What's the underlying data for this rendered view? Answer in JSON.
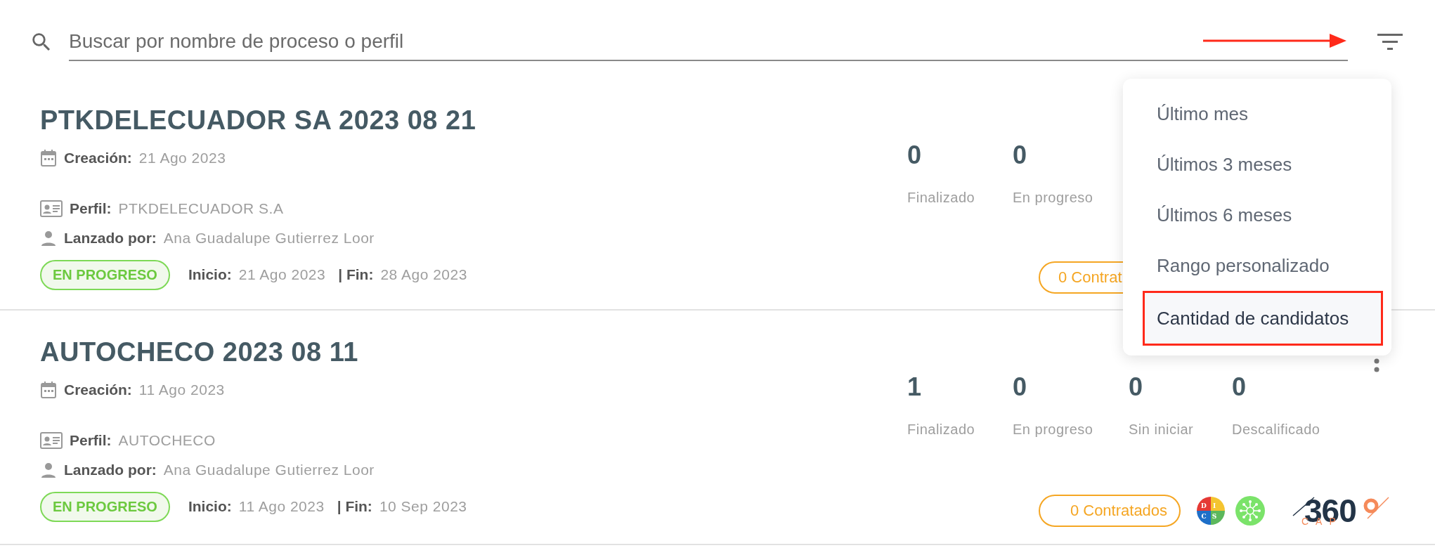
{
  "search": {
    "placeholder": "Buscar por nombre de proceso o perfil"
  },
  "processes": [
    {
      "title": "PTKDELECUADOR SA 2023 08 21",
      "creation_label": "Creación:",
      "creation": "21 Ago 2023",
      "profile_label": "Perfil:",
      "profile": "PTKDELECUADOR S.A",
      "launched_label": "Lanzado por:",
      "launched_by": "Ana Guadalupe Gutierrez Loor",
      "status": "EN PROGRESO",
      "start_label": "Inicio:",
      "start": "21 Ago 2023",
      "end_label": "| Fin:",
      "end": "28 Ago 2023",
      "stats": [
        {
          "value": "0",
          "label": "Finalizado"
        },
        {
          "value": "0",
          "label": "En progreso"
        }
      ],
      "hired": "0 Contrat"
    },
    {
      "title": "AUTOCHECO 2023 08 11",
      "creation_label": "Creación:",
      "creation": "11 Ago 2023",
      "profile_label": "Perfil:",
      "profile": "AUTOCHECO",
      "launched_label": "Lanzado por:",
      "launched_by": "Ana Guadalupe Gutierrez Loor",
      "status": "EN PROGRESO",
      "start_label": "Inicio:",
      "start": "11 Ago 2023",
      "end_label": "| Fin:",
      "end": "10 Sep 2023",
      "stats": [
        {
          "value": "1",
          "label": "Finalizado"
        },
        {
          "value": "0",
          "label": "En progreso"
        },
        {
          "value": "0",
          "label": "Sin iniciar"
        },
        {
          "value": "0",
          "label": "Descalificado"
        }
      ],
      "hired": "0 Contratados",
      "has_menu": true,
      "disc_letters": [
        "D",
        "I",
        "C",
        "S"
      ],
      "logo": {
        "text": "360",
        "subtext": "CAP"
      }
    }
  ],
  "filter_menu": {
    "items": [
      {
        "label": "Último mes",
        "selected": false
      },
      {
        "label": "Últimos 3 meses",
        "selected": false
      },
      {
        "label": "Últimos 6 meses",
        "selected": false
      },
      {
        "label": "Rango personalizado",
        "selected": false
      },
      {
        "label": "Cantidad de candidatos",
        "selected": true
      }
    ]
  }
}
